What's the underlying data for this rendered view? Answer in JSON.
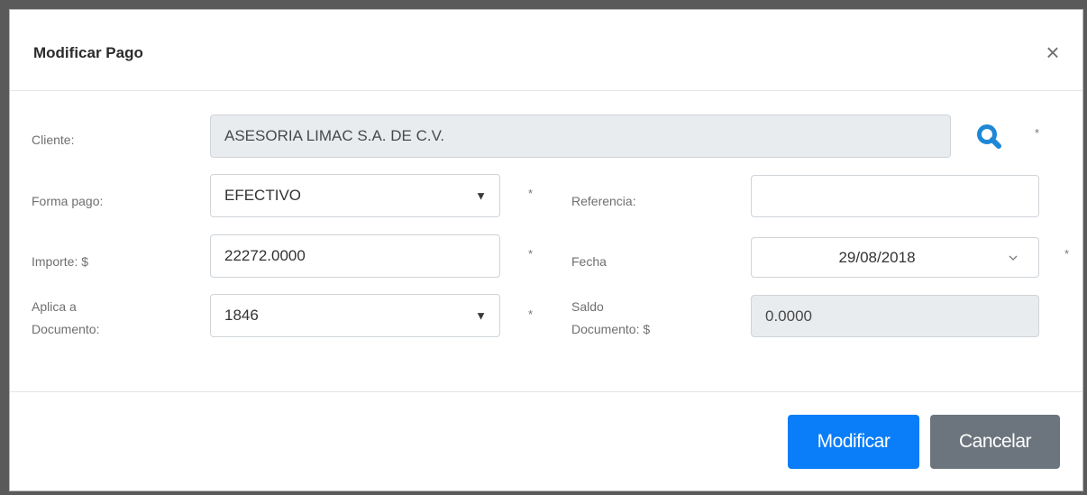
{
  "modal": {
    "title": "Modificar Pago",
    "close_symbol": "×"
  },
  "form": {
    "cliente": {
      "label": "Cliente:",
      "value": "ASESORIA LIMAC S.A. DE C.V.",
      "search_icon": "search-icon",
      "required_mark": "*"
    },
    "forma_pago": {
      "label": "Forma pago:",
      "value": "EFECTIVO",
      "caret": "▼",
      "required_mark": "*"
    },
    "referencia": {
      "label": "Referencia:",
      "value": ""
    },
    "importe": {
      "label": "Importe: $",
      "value": "22272.0000",
      "required_mark": "*"
    },
    "fecha": {
      "label": "Fecha",
      "value": "29/08/2018",
      "required_mark": "*"
    },
    "aplica_documento": {
      "label_line1": "Aplica a",
      "label_line2": "Documento:",
      "value": "1846",
      "caret": "▼",
      "required_mark": "*"
    },
    "saldo_documento": {
      "label_line1": "Saldo",
      "label_line2": "Documento: $",
      "value": "0.0000"
    }
  },
  "buttons": {
    "modificar": "Modificar",
    "cancelar": "Cancelar"
  },
  "colors": {
    "primary": "#0a7df8",
    "secondary": "#6c757d",
    "search_icon": "#1e88d6"
  }
}
